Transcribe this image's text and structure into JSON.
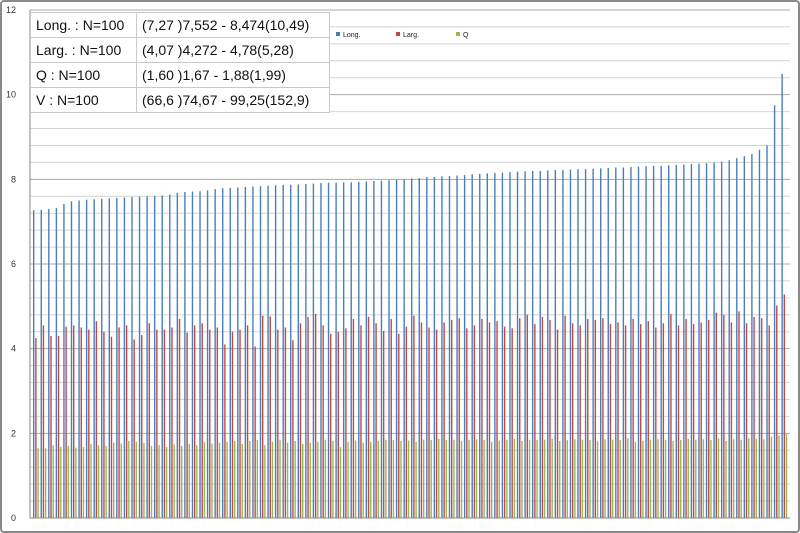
{
  "stats_table": [
    {
      "label": "Long. : N=100",
      "range": "(7,27 )7,552 - 8,474(10,49)"
    },
    {
      "label": "Larg. : N=100",
      "range": "(4,07 )4,272 - 4,78(5,28)"
    },
    {
      "label": "Q : N=100",
      "range": "(1,60 )1,67 - 1,88(1,99)"
    },
    {
      "label": "V : N=100",
      "range": "(66,6 )74,67 - 99,25(152,9)"
    }
  ],
  "chart_data": {
    "type": "bar",
    "title": "",
    "xlabel": "",
    "ylabel": "",
    "ylim": [
      0,
      12
    ],
    "yticks": [
      "0",
      "2",
      "4",
      "6",
      "8",
      "10",
      "12"
    ],
    "grid": true,
    "legend_placement": "top-center",
    "categories_count": 100,
    "series": [
      {
        "name": "Long.",
        "color": "#4a7ebb",
        "values": [
          7.27,
          7.28,
          7.3,
          7.32,
          7.42,
          7.48,
          7.5,
          7.52,
          7.53,
          7.54,
          7.55,
          7.56,
          7.57,
          7.58,
          7.59,
          7.6,
          7.61,
          7.62,
          7.64,
          7.68,
          7.7,
          7.71,
          7.72,
          7.74,
          7.77,
          7.79,
          7.8,
          7.81,
          7.82,
          7.83,
          7.84,
          7.85,
          7.86,
          7.87,
          7.87,
          7.88,
          7.89,
          7.9,
          7.91,
          7.92,
          7.92,
          7.93,
          7.93,
          7.94,
          7.95,
          7.96,
          7.97,
          7.98,
          7.99,
          8.0,
          8.02,
          8.03,
          8.05,
          8.06,
          8.07,
          8.08,
          8.09,
          8.1,
          8.12,
          8.13,
          8.14,
          8.15,
          8.16,
          8.17,
          8.18,
          8.19,
          8.2,
          8.2,
          8.21,
          8.22,
          8.22,
          8.23,
          8.24,
          8.24,
          8.25,
          8.26,
          8.27,
          8.28,
          8.28,
          8.29,
          8.3,
          8.31,
          8.32,
          8.32,
          8.33,
          8.34,
          8.35,
          8.36,
          8.37,
          8.38,
          8.4,
          8.42,
          8.45,
          8.5,
          8.55,
          8.6,
          8.7,
          8.8,
          9.75,
          10.49
        ]
      },
      {
        "name": "Larg.",
        "color": "#be4b48",
        "values": [
          4.25,
          4.55,
          4.3,
          4.3,
          4.52,
          4.55,
          4.5,
          4.45,
          4.65,
          4.4,
          4.28,
          4.5,
          4.55,
          4.22,
          4.32,
          4.6,
          4.45,
          4.45,
          4.5,
          4.7,
          4.38,
          4.55,
          4.6,
          4.45,
          4.5,
          4.1,
          4.4,
          4.45,
          4.55,
          4.05,
          4.78,
          4.76,
          4.45,
          4.5,
          4.2,
          4.6,
          4.75,
          4.82,
          4.55,
          4.35,
          4.4,
          4.48,
          4.7,
          4.55,
          4.75,
          4.6,
          4.42,
          4.7,
          4.35,
          4.52,
          4.78,
          4.62,
          4.5,
          4.45,
          4.62,
          4.68,
          4.72,
          4.48,
          4.55,
          4.7,
          4.62,
          4.65,
          4.52,
          4.48,
          4.72,
          4.8,
          4.58,
          4.75,
          4.68,
          4.45,
          4.78,
          4.6,
          4.55,
          4.7,
          4.68,
          4.72,
          4.58,
          4.62,
          4.55,
          4.7,
          4.58,
          4.65,
          4.5,
          4.6,
          4.82,
          4.55,
          4.7,
          4.58,
          4.62,
          4.68,
          4.85,
          4.8,
          4.62,
          4.88,
          4.6,
          4.75,
          4.72,
          4.55,
          5.02,
          5.28
        ]
      },
      {
        "name": "Q",
        "color": "#98b954",
        "values": [
          1.65,
          1.65,
          1.72,
          1.68,
          1.7,
          1.66,
          1.68,
          1.75,
          1.72,
          1.7,
          1.78,
          1.76,
          1.82,
          1.8,
          1.77,
          1.7,
          1.72,
          1.68,
          1.74,
          1.7,
          1.75,
          1.72,
          1.8,
          1.76,
          1.78,
          1.8,
          1.82,
          1.75,
          1.82,
          1.84,
          1.72,
          1.8,
          1.85,
          1.78,
          1.82,
          1.75,
          1.78,
          1.8,
          1.85,
          1.82,
          1.68,
          1.8,
          1.83,
          1.78,
          1.8,
          1.82,
          1.85,
          1.84,
          1.82,
          1.83,
          1.8,
          1.85,
          1.84,
          1.87,
          1.84,
          1.85,
          1.82,
          1.85,
          1.86,
          1.84,
          1.8,
          1.83,
          1.85,
          1.87,
          1.82,
          1.85,
          1.84,
          1.85,
          1.87,
          1.82,
          1.84,
          1.86,
          1.85,
          1.84,
          1.82,
          1.86,
          1.85,
          1.84,
          1.88,
          1.8,
          1.82,
          1.85,
          1.86,
          1.85,
          1.82,
          1.84,
          1.87,
          1.85,
          1.86,
          1.84,
          1.88,
          1.82,
          1.86,
          1.85,
          1.88,
          1.87,
          1.86,
          1.92,
          1.95,
          1.99
        ]
      }
    ]
  }
}
